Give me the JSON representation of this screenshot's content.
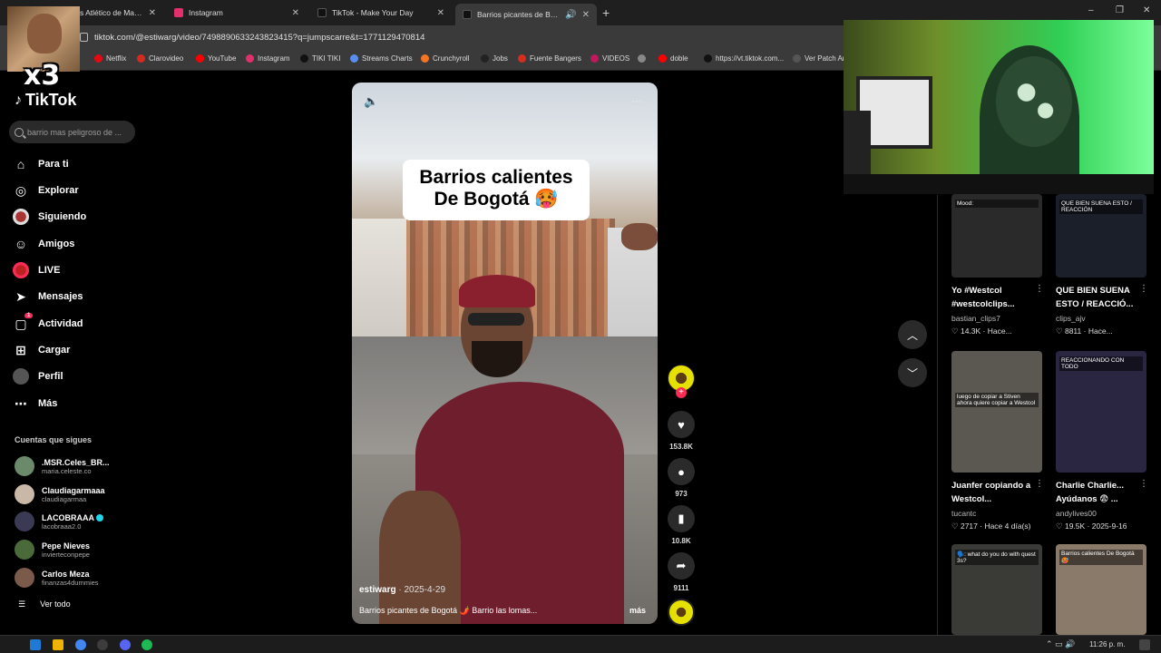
{
  "browser": {
    "tabs": [
      {
        "label": "s Atlético de Madrid",
        "color": "#c8102e",
        "active": false
      },
      {
        "label": "Instagram",
        "color": "#e1306c",
        "active": false
      },
      {
        "label": "TikTok - Make Your Day",
        "color": "#111111",
        "active": false
      },
      {
        "label": "Barrios picantes de Bogotá",
        "color": "#111111",
        "active": true
      }
    ],
    "new_tab": "+",
    "close_glyph": "✕",
    "url": "tiktok.com/@estiwarg/video/7498890633243823415?q=jumpscarre&t=1771129470814",
    "window_controls": [
      "–",
      "❐",
      "✕"
    ],
    "bookmarks": [
      {
        "label": "Netflix",
        "color": "#e50914"
      },
      {
        "label": "Clarovideo",
        "color": "#d52b1e"
      },
      {
        "label": "YouTube",
        "color": "#ff0000"
      },
      {
        "label": "Instagram",
        "color": "#e1306c"
      },
      {
        "label": "TIKI TIKI",
        "color": "#111111"
      },
      {
        "label": "Streams Charts",
        "color": "#5b8def"
      },
      {
        "label": "Crunchyroll",
        "color": "#f47521"
      },
      {
        "label": "Jobs",
        "color": "#222222"
      },
      {
        "label": "Fuente Bangers",
        "color": "#d62d20"
      },
      {
        "label": "VIDEOS",
        "color": "#c2185b"
      },
      {
        "label": "",
        "color": "#888888"
      },
      {
        "label": "doble",
        "color": "#ff0000"
      },
      {
        "label": "https://vt.tiktok.com...",
        "color": "#111111"
      },
      {
        "label": "Ver Patch Ar",
        "color": "#555555"
      }
    ]
  },
  "overlay": {
    "meme_text": "x3"
  },
  "tiktok": {
    "logo": "TikTok",
    "search_placeholder": "barrio mas peligroso de ...",
    "nav": [
      {
        "label": "Para ti",
        "icon": "home-icon",
        "glyph": "⌂"
      },
      {
        "label": "Explorar",
        "icon": "compass-icon",
        "glyph": "◎"
      },
      {
        "label": "Siguiendo",
        "icon": "avatar",
        "glyph": ""
      },
      {
        "label": "Amigos",
        "icon": "friends-icon",
        "glyph": "☺"
      },
      {
        "label": "LIVE",
        "icon": "live-icon",
        "glyph": ""
      },
      {
        "label": "Mensajes",
        "icon": "send-icon",
        "glyph": "➤"
      },
      {
        "label": "Actividad",
        "icon": "activity-icon",
        "glyph": "▢",
        "badge": "1"
      },
      {
        "label": "Cargar",
        "icon": "upload-icon",
        "glyph": "⊞"
      },
      {
        "label": "Perfil",
        "icon": "avatar",
        "glyph": ""
      },
      {
        "label": "Más",
        "icon": "more-icon",
        "glyph": "⋯"
      }
    ],
    "following_header": "Cuentas que sigues",
    "following": [
      {
        "name": ".MSR.Celes_BR...",
        "handle": "maria.celeste.co",
        "color": "#6b8a6b"
      },
      {
        "name": "Claudiagarmaaa",
        "handle": "claudiagarmaa",
        "color": "#c9b8a8"
      },
      {
        "name": "LACOBRAAA",
        "handle": "lacobraaa2.0",
        "color": "#3a3a55",
        "verified": true
      },
      {
        "name": "Pepe Nieves",
        "handle": "invierteconpepe",
        "color": "#4a6a3a"
      },
      {
        "name": "Carlos Meza",
        "handle": "finanzas4dummies",
        "color": "#7a5a4a"
      }
    ],
    "see_all": "Ver todo",
    "see_all_glyph": "☰",
    "video": {
      "caption_line1": "Barrios calientes",
      "caption_line2": "De Bogotá 🥵",
      "author": "estiwarg",
      "date": "· 2025-4-29",
      "description": "Barrios picantes de Bogotá 🌶️ Barrio las lomas...",
      "more": "más",
      "mute_glyph": "🔈",
      "menu_glyph": "···"
    },
    "actions": {
      "likes": "153.8K",
      "comments": "973",
      "saves": "10.8K",
      "shares": "9111",
      "plus": "+",
      "like_glyph": "♥",
      "comment_glyph": "●",
      "save_glyph": "▮",
      "share_glyph": "➦"
    },
    "arrows": {
      "up": "︿",
      "down": "﹀"
    },
    "related": [
      {
        "title": "Yo #Westcol #westcolclips...",
        "user": "bastian_clips7",
        "stats": "♡ 14.3K · Hace...",
        "bg": "#2a2a2a",
        "inner": "Mood:"
      },
      {
        "title": "QUE BIEN SUENA ESTO / REACCIÓ...",
        "user": "clips_ajv",
        "stats": "♡ 8811 · Hace...",
        "bg": "#1a1f2a",
        "inner": "QUE BIEN SUENA ESTO / REACCIÓN"
      },
      {
        "title": "Juanfer copiando a Westcol...",
        "user": "tucantc",
        "stats": "♡ 2717 · Hace 4 día(s)",
        "bg": "#5a5850",
        "inner": "luego de copiar a Stiven ahora quiere copiar a Westcol"
      },
      {
        "title": "Charlie Charlie... Ayúdanos 😨 ...",
        "user": "andylives00",
        "stats": "♡ 19.5K · 2025-9-16",
        "bg": "#2a2540",
        "inner": "REACCIONANDO CON TODO"
      },
      {
        "title": "",
        "user": "",
        "stats": "",
        "bg": "#3a3a36",
        "inner": "🗣️: what do you do with quest 3s?"
      },
      {
        "title": "",
        "user": "",
        "stats": "",
        "bg": "#8a7a6a",
        "inner": "Barrios calientes De Bogotá 🥵"
      }
    ],
    "item_menu": "⋮"
  },
  "taskbar": {
    "time": "11:26 p. m.",
    "tray": "⌃ ▭ 🔊",
    "apps": [
      "#1f7ad6",
      "#f0b400",
      "#4285f4",
      "#3c3c3c",
      "#5865f2",
      "#1db954"
    ]
  }
}
